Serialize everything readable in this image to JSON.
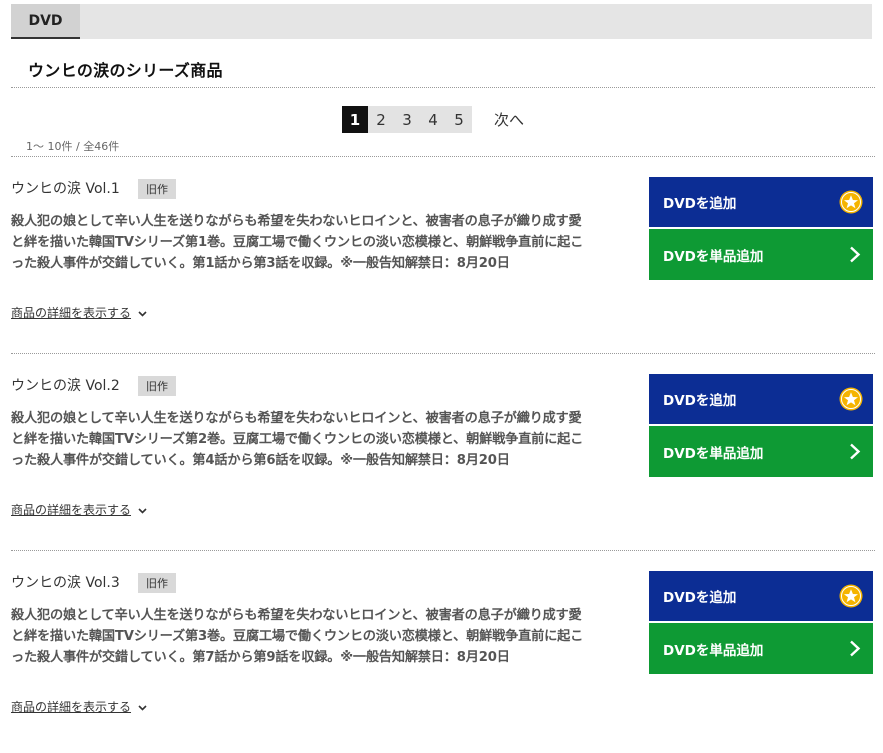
{
  "tab": {
    "label": "DVD"
  },
  "series_title": "ウンヒの涙のシリーズ商品",
  "pager": {
    "pages": [
      "1",
      "2",
      "3",
      "4",
      "5"
    ],
    "active": "1",
    "next_label": "次へ"
  },
  "count_text": "1～ 10件 / 全46件",
  "items": [
    {
      "title": "ウンヒの涙 Vol.1",
      "badge": "旧作",
      "desc_lines": [
        "殺人犯の娘として辛い人生を送りながらも希望を失わないヒロインと、被害者の息子が織り成す愛",
        "と絆を描いた韓国TVシリーズ第1巻。豆腐工場で働くウンヒの淡い恋模様と、朝鮮戦争直前に起こ",
        "った殺人事件が交錯していく。第1話から第3話を収録。※一般告知解禁日：8月20日"
      ],
      "details_label": "商品の詳細を表示する",
      "add_label": "DVDを追加",
      "single_label": "DVDを単品追加"
    },
    {
      "title": "ウンヒの涙 Vol.2",
      "badge": "旧作",
      "desc_lines": [
        "殺人犯の娘として辛い人生を送りながらも希望を失わないヒロインと、被害者の息子が織り成す愛",
        "と絆を描いた韓国TVシリーズ第2巻。豆腐工場で働くウンヒの淡い恋模様と、朝鮮戦争直前に起こ",
        "った殺人事件が交錯していく。第4話から第6話を収録。※一般告知解禁日：8月20日"
      ],
      "details_label": "商品の詳細を表示する",
      "add_label": "DVDを追加",
      "single_label": "DVDを単品追加"
    },
    {
      "title": "ウンヒの涙 Vol.3",
      "badge": "旧作",
      "desc_lines": [
        "殺人犯の娘として辛い人生を送りながらも希望を失わないヒロインと、被害者の息子が織り成す愛",
        "と絆を描いた韓国TVシリーズ第3巻。豆腐工場で働くウンヒの淡い恋模様と、朝鮮戦争直前に起こ",
        "った殺人事件が交錯していく。第7話から第9話を収録。※一般告知解禁日：8月20日"
      ],
      "details_label": "商品の詳細を表示する",
      "add_label": "DVDを追加",
      "single_label": "DVDを単品追加"
    }
  ],
  "colors": {
    "add_button": "#0c2d94",
    "single_button": "#0e9a34",
    "star": "#f5b400"
  },
  "icons": {
    "add": "star-icon",
    "single": "chevron-right-icon",
    "details": "chevron-down-icon"
  }
}
